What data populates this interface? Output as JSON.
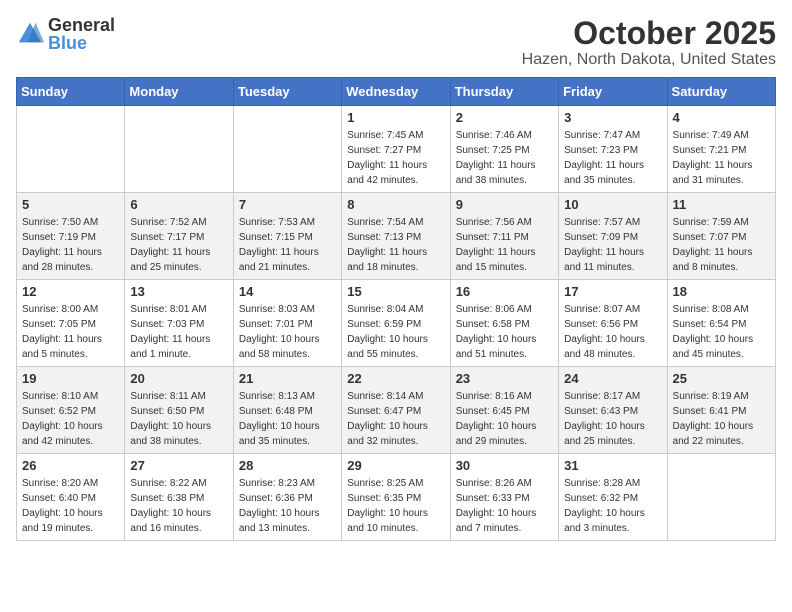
{
  "header": {
    "logo_general": "General",
    "logo_blue": "Blue",
    "title": "October 2025",
    "subtitle": "Hazen, North Dakota, United States"
  },
  "days_of_week": [
    "Sunday",
    "Monday",
    "Tuesday",
    "Wednesday",
    "Thursday",
    "Friday",
    "Saturday"
  ],
  "weeks": [
    [
      {
        "day": "",
        "sunrise": "",
        "sunset": "",
        "daylight": ""
      },
      {
        "day": "",
        "sunrise": "",
        "sunset": "",
        "daylight": ""
      },
      {
        "day": "",
        "sunrise": "",
        "sunset": "",
        "daylight": ""
      },
      {
        "day": "1",
        "sunrise": "Sunrise: 7:45 AM",
        "sunset": "Sunset: 7:27 PM",
        "daylight": "Daylight: 11 hours and 42 minutes."
      },
      {
        "day": "2",
        "sunrise": "Sunrise: 7:46 AM",
        "sunset": "Sunset: 7:25 PM",
        "daylight": "Daylight: 11 hours and 38 minutes."
      },
      {
        "day": "3",
        "sunrise": "Sunrise: 7:47 AM",
        "sunset": "Sunset: 7:23 PM",
        "daylight": "Daylight: 11 hours and 35 minutes."
      },
      {
        "day": "4",
        "sunrise": "Sunrise: 7:49 AM",
        "sunset": "Sunset: 7:21 PM",
        "daylight": "Daylight: 11 hours and 31 minutes."
      }
    ],
    [
      {
        "day": "5",
        "sunrise": "Sunrise: 7:50 AM",
        "sunset": "Sunset: 7:19 PM",
        "daylight": "Daylight: 11 hours and 28 minutes."
      },
      {
        "day": "6",
        "sunrise": "Sunrise: 7:52 AM",
        "sunset": "Sunset: 7:17 PM",
        "daylight": "Daylight: 11 hours and 25 minutes."
      },
      {
        "day": "7",
        "sunrise": "Sunrise: 7:53 AM",
        "sunset": "Sunset: 7:15 PM",
        "daylight": "Daylight: 11 hours and 21 minutes."
      },
      {
        "day": "8",
        "sunrise": "Sunrise: 7:54 AM",
        "sunset": "Sunset: 7:13 PM",
        "daylight": "Daylight: 11 hours and 18 minutes."
      },
      {
        "day": "9",
        "sunrise": "Sunrise: 7:56 AM",
        "sunset": "Sunset: 7:11 PM",
        "daylight": "Daylight: 11 hours and 15 minutes."
      },
      {
        "day": "10",
        "sunrise": "Sunrise: 7:57 AM",
        "sunset": "Sunset: 7:09 PM",
        "daylight": "Daylight: 11 hours and 11 minutes."
      },
      {
        "day": "11",
        "sunrise": "Sunrise: 7:59 AM",
        "sunset": "Sunset: 7:07 PM",
        "daylight": "Daylight: 11 hours and 8 minutes."
      }
    ],
    [
      {
        "day": "12",
        "sunrise": "Sunrise: 8:00 AM",
        "sunset": "Sunset: 7:05 PM",
        "daylight": "Daylight: 11 hours and 5 minutes."
      },
      {
        "day": "13",
        "sunrise": "Sunrise: 8:01 AM",
        "sunset": "Sunset: 7:03 PM",
        "daylight": "Daylight: 11 hours and 1 minute."
      },
      {
        "day": "14",
        "sunrise": "Sunrise: 8:03 AM",
        "sunset": "Sunset: 7:01 PM",
        "daylight": "Daylight: 10 hours and 58 minutes."
      },
      {
        "day": "15",
        "sunrise": "Sunrise: 8:04 AM",
        "sunset": "Sunset: 6:59 PM",
        "daylight": "Daylight: 10 hours and 55 minutes."
      },
      {
        "day": "16",
        "sunrise": "Sunrise: 8:06 AM",
        "sunset": "Sunset: 6:58 PM",
        "daylight": "Daylight: 10 hours and 51 minutes."
      },
      {
        "day": "17",
        "sunrise": "Sunrise: 8:07 AM",
        "sunset": "Sunset: 6:56 PM",
        "daylight": "Daylight: 10 hours and 48 minutes."
      },
      {
        "day": "18",
        "sunrise": "Sunrise: 8:08 AM",
        "sunset": "Sunset: 6:54 PM",
        "daylight": "Daylight: 10 hours and 45 minutes."
      }
    ],
    [
      {
        "day": "19",
        "sunrise": "Sunrise: 8:10 AM",
        "sunset": "Sunset: 6:52 PM",
        "daylight": "Daylight: 10 hours and 42 minutes."
      },
      {
        "day": "20",
        "sunrise": "Sunrise: 8:11 AM",
        "sunset": "Sunset: 6:50 PM",
        "daylight": "Daylight: 10 hours and 38 minutes."
      },
      {
        "day": "21",
        "sunrise": "Sunrise: 8:13 AM",
        "sunset": "Sunset: 6:48 PM",
        "daylight": "Daylight: 10 hours and 35 minutes."
      },
      {
        "day": "22",
        "sunrise": "Sunrise: 8:14 AM",
        "sunset": "Sunset: 6:47 PM",
        "daylight": "Daylight: 10 hours and 32 minutes."
      },
      {
        "day": "23",
        "sunrise": "Sunrise: 8:16 AM",
        "sunset": "Sunset: 6:45 PM",
        "daylight": "Daylight: 10 hours and 29 minutes."
      },
      {
        "day": "24",
        "sunrise": "Sunrise: 8:17 AM",
        "sunset": "Sunset: 6:43 PM",
        "daylight": "Daylight: 10 hours and 25 minutes."
      },
      {
        "day": "25",
        "sunrise": "Sunrise: 8:19 AM",
        "sunset": "Sunset: 6:41 PM",
        "daylight": "Daylight: 10 hours and 22 minutes."
      }
    ],
    [
      {
        "day": "26",
        "sunrise": "Sunrise: 8:20 AM",
        "sunset": "Sunset: 6:40 PM",
        "daylight": "Daylight: 10 hours and 19 minutes."
      },
      {
        "day": "27",
        "sunrise": "Sunrise: 8:22 AM",
        "sunset": "Sunset: 6:38 PM",
        "daylight": "Daylight: 10 hours and 16 minutes."
      },
      {
        "day": "28",
        "sunrise": "Sunrise: 8:23 AM",
        "sunset": "Sunset: 6:36 PM",
        "daylight": "Daylight: 10 hours and 13 minutes."
      },
      {
        "day": "29",
        "sunrise": "Sunrise: 8:25 AM",
        "sunset": "Sunset: 6:35 PM",
        "daylight": "Daylight: 10 hours and 10 minutes."
      },
      {
        "day": "30",
        "sunrise": "Sunrise: 8:26 AM",
        "sunset": "Sunset: 6:33 PM",
        "daylight": "Daylight: 10 hours and 7 minutes."
      },
      {
        "day": "31",
        "sunrise": "Sunrise: 8:28 AM",
        "sunset": "Sunset: 6:32 PM",
        "daylight": "Daylight: 10 hours and 3 minutes."
      },
      {
        "day": "",
        "sunrise": "",
        "sunset": "",
        "daylight": ""
      }
    ]
  ]
}
